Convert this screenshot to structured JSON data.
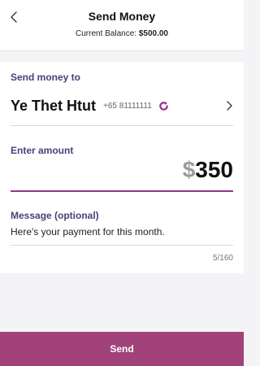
{
  "header": {
    "title": "Send Money",
    "balance_label": "Current Balance:",
    "balance_value": "$500.00"
  },
  "recipient": {
    "label": "Send money to",
    "name": "Ye Thet Htut",
    "phone": "+65 81111111"
  },
  "amount": {
    "label": "Enter amount",
    "currency": "$",
    "value": "350"
  },
  "message": {
    "label": "Message (optional)",
    "text": "Here's your payment for this month.",
    "char_count": "5/160"
  },
  "footer": {
    "send_label": "Send"
  },
  "icons": {
    "back": "chevron-left-icon",
    "recipient_action": "refresh-icon",
    "recipient_open": "chevron-right-icon"
  },
  "colors": {
    "accent": "#a2427a",
    "underline": "#8e3a87",
    "label": "#4a3f7a",
    "refresh_icon": "#9b2f8d"
  }
}
